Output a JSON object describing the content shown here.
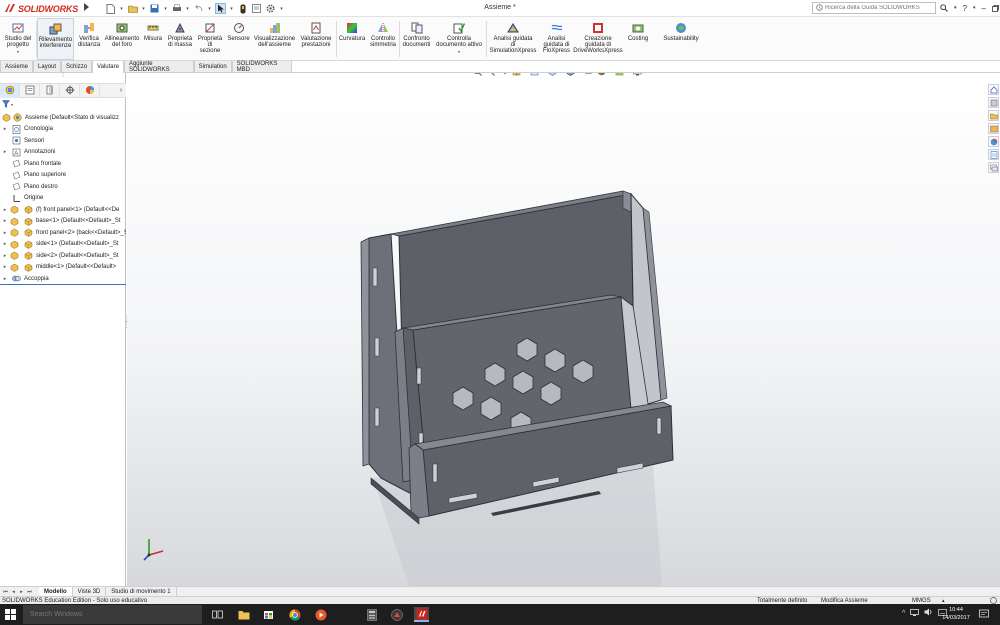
{
  "app": {
    "brand": "SOLIDWORKS",
    "document_title": "Assieme *"
  },
  "search": {
    "placeholder": "Ricerca della Guida SOLIDWORKS"
  },
  "ribbon": {
    "buttons": [
      {
        "id": "studio",
        "label": "Studio del\nprogetto",
        "icon": "design-study-icon"
      },
      {
        "id": "rilevamento",
        "label": "Rilevamento\ninterferenze",
        "icon": "interference-icon"
      },
      {
        "id": "verifica",
        "label": "Verifica\ndistanza",
        "icon": "clearance-icon"
      },
      {
        "id": "allineamento",
        "label": "Allineamento\ndel foro",
        "icon": "hole-alignment-icon"
      },
      {
        "id": "misura",
        "label": "Misura",
        "icon": "measure-icon"
      },
      {
        "id": "proprieta_massa",
        "label": "Proprietà\ndi massa",
        "icon": "mass-properties-icon"
      },
      {
        "id": "proprieta_sezione",
        "label": "Proprietà\ndi\nsezione",
        "icon": "section-properties-icon"
      },
      {
        "id": "sensore",
        "label": "Sensore",
        "icon": "sensor-icon"
      },
      {
        "id": "valutazione_assieme",
        "label": "Visualizzazione\ndell'assieme",
        "icon": "assembly-visualization-icon"
      },
      {
        "id": "valutazione_prestazioni",
        "label": "Valutazione\nprestazioni",
        "icon": "performance-icon"
      },
      {
        "id": "curvatura",
        "label": "Curvatura",
        "icon": "curvature-icon"
      },
      {
        "id": "simmetria",
        "label": "Controllo\nsimmetria",
        "icon": "symmetry-icon"
      },
      {
        "id": "confronto",
        "label": "Confronto\ndocumenti",
        "icon": "compare-icon"
      },
      {
        "id": "controlla",
        "label": "Controlla\ndocumento attivo",
        "icon": "check-active-icon"
      },
      {
        "id": "simulation",
        "label": "Analisi guidata\ndi\nSimulationXpress",
        "icon": "simulationxpress-icon"
      },
      {
        "id": "flo",
        "label": "Analisi\nguidata di\nFloXpress",
        "icon": "floxpress-icon"
      },
      {
        "id": "drive",
        "label": "Creazione\nguidata di\nDriveWorksXpress",
        "icon": "driveworks-icon"
      },
      {
        "id": "costing",
        "label": "Costing",
        "icon": "costing-icon"
      },
      {
        "id": "sustainability",
        "label": "Sustainability",
        "icon": "sustainability-icon"
      }
    ]
  },
  "tabs": [
    "Assieme",
    "Layout",
    "Schizzo",
    "Valutare",
    "Aggiunte SOLIDWORKS",
    "Simulation",
    "SOLIDWORKS MBD"
  ],
  "active_tab": "Valutare",
  "tree": [
    {
      "label": "Assieme  (Default<Stato di visualizz",
      "icon": "assembly-icon",
      "level": 0,
      "expand": ""
    },
    {
      "label": "Cronologia",
      "icon": "history-icon",
      "level": 1,
      "expand": "▸"
    },
    {
      "label": "Sensori",
      "icon": "sensor-folder-icon",
      "level": 1,
      "expand": ""
    },
    {
      "label": "Annotazioni",
      "icon": "annotations-icon",
      "level": 1,
      "expand": "▸"
    },
    {
      "label": "Piano frontale",
      "icon": "plane-icon",
      "level": 1,
      "expand": ""
    },
    {
      "label": "Piano superiore",
      "icon": "plane-icon",
      "level": 1,
      "expand": ""
    },
    {
      "label": "Piano destro",
      "icon": "plane-icon",
      "level": 1,
      "expand": ""
    },
    {
      "label": "Origine",
      "icon": "origin-icon",
      "level": 1,
      "expand": ""
    },
    {
      "label": "(f) front panel<1> (Default<<De",
      "icon": "part-icon",
      "level": 1,
      "expand": "▸"
    },
    {
      "label": "base<1> (Default<<Default>_St",
      "icon": "part-icon",
      "level": 1,
      "expand": "▸"
    },
    {
      "label": "front panel<2> (back<<Default>_St",
      "icon": "part-icon",
      "level": 1,
      "expand": "▸"
    },
    {
      "label": "side<1> (Default<<Default>_St",
      "icon": "part-icon",
      "level": 1,
      "expand": "▸"
    },
    {
      "label": "side<2> (Default<<Default>_St",
      "icon": "part-icon",
      "level": 1,
      "expand": "▸"
    },
    {
      "label": "middle<1> (Default<<Default>",
      "icon": "part-icon",
      "level": 1,
      "expand": "▸"
    },
    {
      "label": "Accoppia",
      "icon": "mates-icon",
      "level": 1,
      "expand": "▸"
    }
  ],
  "bottom_tabs": [
    "Modello",
    "Viste 3D",
    "Studio di movimento 1"
  ],
  "active_bottom_tab": "Modello",
  "status": {
    "left": "SOLIDWORKS Education Edition - Solo uso educativo",
    "defined": "Totalmente definito",
    "mode": "Modifica Assieme",
    "units": "MMGS"
  },
  "taskbar": {
    "search_placeholder": "Search Windows",
    "time": "10:44",
    "date": "14/03/2017"
  },
  "colors": {
    "brand_red": "#d52b1e",
    "part_gray": "#5f6169",
    "selection_blue": "#3a6fc4"
  }
}
